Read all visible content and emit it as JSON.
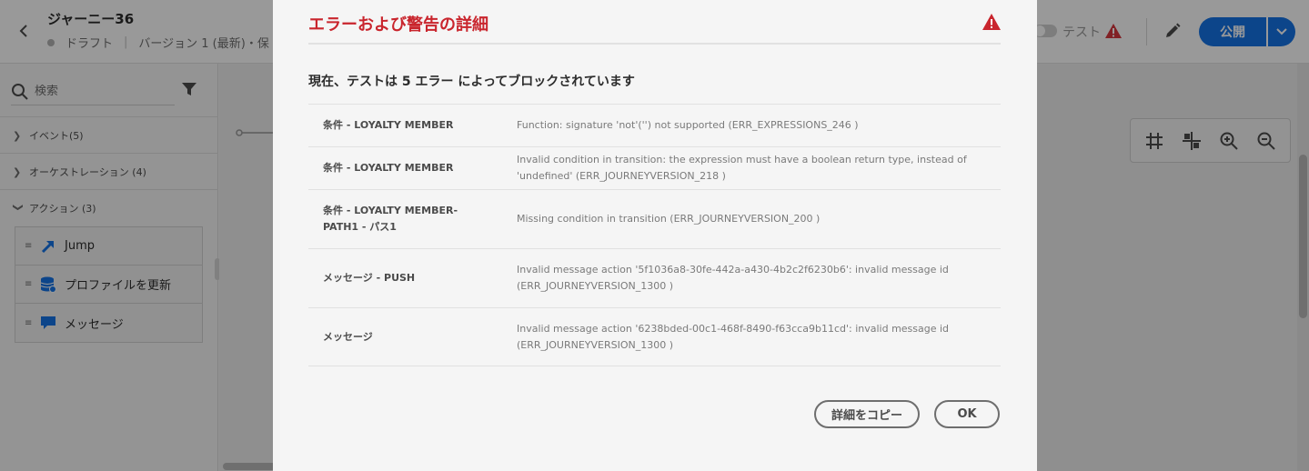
{
  "header": {
    "title": "ジャーニー36",
    "status": "ドラフト",
    "version": "バージョン 1 (最新)・保",
    "test_label": "テスト",
    "publish_label": "公開"
  },
  "left_panel": {
    "search_placeholder": "検索",
    "sections": [
      {
        "label": "イベント(5)"
      },
      {
        "label": "オーケストレーション (4)"
      },
      {
        "label": "アクション (3)"
      }
    ],
    "actions": [
      {
        "label": "Jump",
        "icon": "jump-arrow-icon"
      },
      {
        "label": "プロファイルを更新",
        "icon": "database-update-icon"
      },
      {
        "label": "メッセージ",
        "icon": "message-bubble-icon"
      }
    ]
  },
  "modal": {
    "title": "エラーおよび警告の詳細",
    "summary": "現在、テストは 5 エラー によってブロックされています",
    "errors": [
      {
        "node": "条件 - LOYALTY MEMBER",
        "message": "Function: signature 'not'('') not supported (ERR_EXPRESSIONS_246 )"
      },
      {
        "node": "条件 - LOYALTY MEMBER",
        "message": "Invalid condition in transition: the expression must have a boolean return type, instead of 'undefined' (ERR_JOURNEYVERSION_218 )"
      },
      {
        "node": "条件 - LOYALTY MEMBER-PATH1 - パス1",
        "message": "Missing condition in transition (ERR_JOURNEYVERSION_200 )"
      },
      {
        "node": "メッセージ - PUSH",
        "message": "Invalid message action '5f1036a8-30fe-442a-a430-4b2c2f6230b6': invalid message id (ERR_JOURNEYVERSION_1300 )"
      },
      {
        "node": "メッセージ",
        "message": "Invalid message action '6238bded-00c1-468f-8490-f63cca9b11cd': invalid message id (ERR_JOURNEYVERSION_1300 )"
      }
    ],
    "copy_label": "詳細をコピー",
    "ok_label": "OK"
  },
  "colors": {
    "accent_blue": "#1473e6",
    "error_red": "#c9252d",
    "alert_red": "#d7373f"
  }
}
